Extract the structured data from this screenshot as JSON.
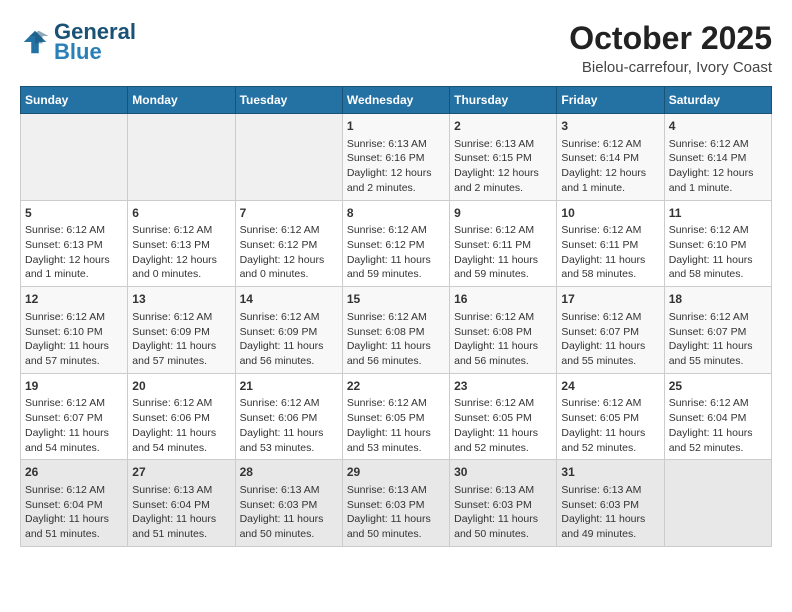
{
  "header": {
    "logo_line1": "General",
    "logo_line2": "Blue",
    "month": "October 2025",
    "location": "Bielou-carrefour, Ivory Coast"
  },
  "weekdays": [
    "Sunday",
    "Monday",
    "Tuesday",
    "Wednesday",
    "Thursday",
    "Friday",
    "Saturday"
  ],
  "weeks": [
    [
      {
        "day": "",
        "info": ""
      },
      {
        "day": "",
        "info": ""
      },
      {
        "day": "",
        "info": ""
      },
      {
        "day": "1",
        "info": "Sunrise: 6:13 AM\nSunset: 6:16 PM\nDaylight: 12 hours\nand 2 minutes."
      },
      {
        "day": "2",
        "info": "Sunrise: 6:13 AM\nSunset: 6:15 PM\nDaylight: 12 hours\nand 2 minutes."
      },
      {
        "day": "3",
        "info": "Sunrise: 6:12 AM\nSunset: 6:14 PM\nDaylight: 12 hours\nand 1 minute."
      },
      {
        "day": "4",
        "info": "Sunrise: 6:12 AM\nSunset: 6:14 PM\nDaylight: 12 hours\nand 1 minute."
      }
    ],
    [
      {
        "day": "5",
        "info": "Sunrise: 6:12 AM\nSunset: 6:13 PM\nDaylight: 12 hours\nand 1 minute."
      },
      {
        "day": "6",
        "info": "Sunrise: 6:12 AM\nSunset: 6:13 PM\nDaylight: 12 hours\nand 0 minutes."
      },
      {
        "day": "7",
        "info": "Sunrise: 6:12 AM\nSunset: 6:12 PM\nDaylight: 12 hours\nand 0 minutes."
      },
      {
        "day": "8",
        "info": "Sunrise: 6:12 AM\nSunset: 6:12 PM\nDaylight: 11 hours\nand 59 minutes."
      },
      {
        "day": "9",
        "info": "Sunrise: 6:12 AM\nSunset: 6:11 PM\nDaylight: 11 hours\nand 59 minutes."
      },
      {
        "day": "10",
        "info": "Sunrise: 6:12 AM\nSunset: 6:11 PM\nDaylight: 11 hours\nand 58 minutes."
      },
      {
        "day": "11",
        "info": "Sunrise: 6:12 AM\nSunset: 6:10 PM\nDaylight: 11 hours\nand 58 minutes."
      }
    ],
    [
      {
        "day": "12",
        "info": "Sunrise: 6:12 AM\nSunset: 6:10 PM\nDaylight: 11 hours\nand 57 minutes."
      },
      {
        "day": "13",
        "info": "Sunrise: 6:12 AM\nSunset: 6:09 PM\nDaylight: 11 hours\nand 57 minutes."
      },
      {
        "day": "14",
        "info": "Sunrise: 6:12 AM\nSunset: 6:09 PM\nDaylight: 11 hours\nand 56 minutes."
      },
      {
        "day": "15",
        "info": "Sunrise: 6:12 AM\nSunset: 6:08 PM\nDaylight: 11 hours\nand 56 minutes."
      },
      {
        "day": "16",
        "info": "Sunrise: 6:12 AM\nSunset: 6:08 PM\nDaylight: 11 hours\nand 56 minutes."
      },
      {
        "day": "17",
        "info": "Sunrise: 6:12 AM\nSunset: 6:07 PM\nDaylight: 11 hours\nand 55 minutes."
      },
      {
        "day": "18",
        "info": "Sunrise: 6:12 AM\nSunset: 6:07 PM\nDaylight: 11 hours\nand 55 minutes."
      }
    ],
    [
      {
        "day": "19",
        "info": "Sunrise: 6:12 AM\nSunset: 6:07 PM\nDaylight: 11 hours\nand 54 minutes."
      },
      {
        "day": "20",
        "info": "Sunrise: 6:12 AM\nSunset: 6:06 PM\nDaylight: 11 hours\nand 54 minutes."
      },
      {
        "day": "21",
        "info": "Sunrise: 6:12 AM\nSunset: 6:06 PM\nDaylight: 11 hours\nand 53 minutes."
      },
      {
        "day": "22",
        "info": "Sunrise: 6:12 AM\nSunset: 6:05 PM\nDaylight: 11 hours\nand 53 minutes."
      },
      {
        "day": "23",
        "info": "Sunrise: 6:12 AM\nSunset: 6:05 PM\nDaylight: 11 hours\nand 52 minutes."
      },
      {
        "day": "24",
        "info": "Sunrise: 6:12 AM\nSunset: 6:05 PM\nDaylight: 11 hours\nand 52 minutes."
      },
      {
        "day": "25",
        "info": "Sunrise: 6:12 AM\nSunset: 6:04 PM\nDaylight: 11 hours\nand 52 minutes."
      }
    ],
    [
      {
        "day": "26",
        "info": "Sunrise: 6:12 AM\nSunset: 6:04 PM\nDaylight: 11 hours\nand 51 minutes."
      },
      {
        "day": "27",
        "info": "Sunrise: 6:13 AM\nSunset: 6:04 PM\nDaylight: 11 hours\nand 51 minutes."
      },
      {
        "day": "28",
        "info": "Sunrise: 6:13 AM\nSunset: 6:03 PM\nDaylight: 11 hours\nand 50 minutes."
      },
      {
        "day": "29",
        "info": "Sunrise: 6:13 AM\nSunset: 6:03 PM\nDaylight: 11 hours\nand 50 minutes."
      },
      {
        "day": "30",
        "info": "Sunrise: 6:13 AM\nSunset: 6:03 PM\nDaylight: 11 hours\nand 50 minutes."
      },
      {
        "day": "31",
        "info": "Sunrise: 6:13 AM\nSunset: 6:03 PM\nDaylight: 11 hours\nand 49 minutes."
      },
      {
        "day": "",
        "info": ""
      }
    ]
  ]
}
